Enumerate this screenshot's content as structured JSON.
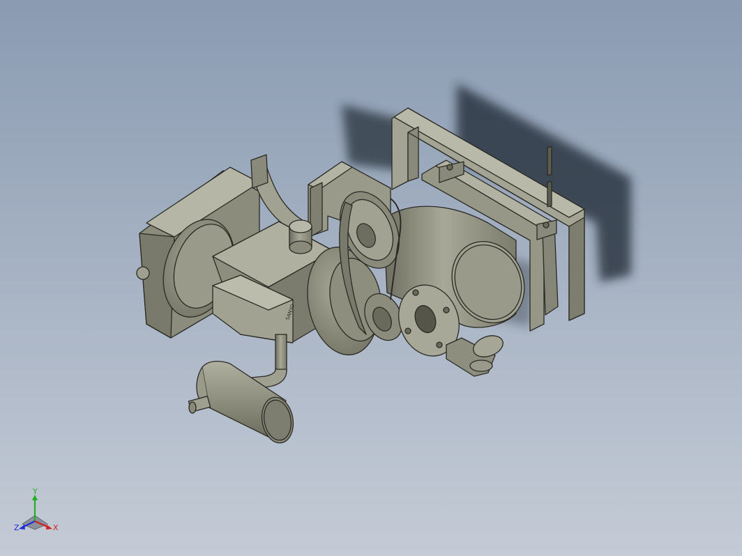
{
  "scene": {
    "background_top": "#8a9bb2",
    "background_bottom": "#c4cbd6",
    "part_color": "#9d9d8c",
    "shadow_color": "#1c2630"
  },
  "triad": {
    "x_label": "X",
    "y_label": "Y",
    "z_label": "Z",
    "x_color": "#d02020",
    "y_color": "#20b020",
    "z_color": "#2030d0"
  }
}
